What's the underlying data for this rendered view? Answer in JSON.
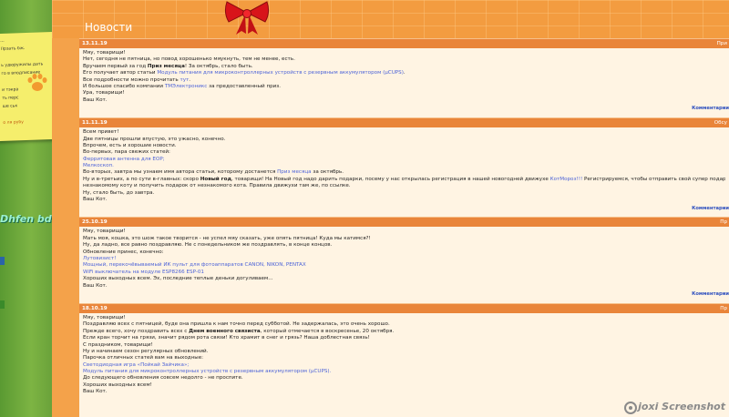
{
  "header": {
    "title": "Новости"
  },
  "sidebar": {
    "note_lines": [
      "...",
      "Прзать бж.",
      "",
      "ь удюружилы дать",
      "го в вподписание",
      "",
      "и тэкра",
      "ть перс",
      "ше ськ",
      "",
      "о ля рубу"
    ],
    "green_caption": "Dhfen bda"
  },
  "posts": [
    {
      "date": "13.11.19",
      "tag": "При",
      "lines": [
        [
          {
            "t": "Мяу, товарищи!"
          }
        ],
        [
          {
            "t": "Нет, сегодня не пятница, но повод хорошенько мяукнуть, тем не менее, есть."
          }
        ],
        [
          {
            "t": "Вручаем первый за год "
          },
          {
            "t": "Приз месяца",
            "b": 1
          },
          {
            "t": "! За октябрь, стало быть."
          }
        ],
        [
          {
            "t": "Его получает автор статьи "
          },
          {
            "t": "Модуль питания для микроконтроллерных устройств с резервным аккумулятором (µCUPS)",
            "l": 1
          },
          {
            "t": "."
          }
        ],
        [
          {
            "t": "Все подробности можно прочитать "
          },
          {
            "t": "тут",
            "l": 1
          },
          {
            "t": "."
          }
        ],
        [
          {
            "t": "И большое спасибо компании "
          },
          {
            "t": "TMЭлектроникс",
            "l": 1
          },
          {
            "t": " за предоставленный приз."
          }
        ],
        [
          {
            "t": "Ура, товарищи!"
          }
        ],
        [
          {
            "t": "Ваш Кот."
          }
        ]
      ],
      "comments": "Комментарии"
    },
    {
      "date": "11.11.19",
      "tag": "Обсу",
      "lines": [
        [
          {
            "t": "Всем привет!"
          }
        ],
        [
          {
            "t": "Две пятницы прошли впустую, это ужасно, конечно."
          }
        ],
        [
          {
            "t": "Впрочем, есть и хорошие новости."
          }
        ],
        [
          {
            "t": "Во-первых, пара свежих статей:"
          }
        ],
        [
          {
            "t": "Ферритовая антенна для ЕОР;",
            "l": 1
          }
        ],
        [
          {
            "t": "Мелкоскоп.",
            "l": 1
          }
        ],
        [
          {
            "t": "Во-вторых, завтра мы узнаем имя автора статьи, которому достанется "
          },
          {
            "t": "Приз месяца",
            "l": 1
          },
          {
            "t": " за октябрь."
          }
        ],
        [
          {
            "t": "Ну и в-третьих, а по сути в-главных: скоро "
          },
          {
            "t": "Новый год",
            "b": 1
          },
          {
            "t": ", товарищи! На Новый год надо дарить подарки, посему у нас открылась регистрация в нашей новогодней движухе "
          },
          {
            "t": "КотМороз!!!",
            "l": 1
          },
          {
            "t": " Регистрируемся, чтобы отправить свой супер подарок"
          }
        ],
        [
          {
            "t": "незнакомому коту и получить подарок от незнакомого кота. Правила движухи там же, по ссылке."
          }
        ],
        [
          {
            "t": "Ну, стало быть, до завтра."
          }
        ],
        [
          {
            "t": "Ваш Кот."
          }
        ]
      ],
      "comments": "Комментарии"
    },
    {
      "date": "25.10.19",
      "tag": "Пр",
      "lines": [
        [
          {
            "t": "Мяу, товарищи!"
          }
        ],
        [
          {
            "t": "Мать моя, кошка, это шож такое творится - не успел мяу сказать, уже опять пятница! Куда мы катимся?!"
          }
        ],
        [
          {
            "t": "Ну, да ладно, все равно поздравляю. Не с понедельником же поздравлять, в конце концов."
          }
        ],
        [
          {
            "t": "Обновление принес, конечно:"
          }
        ],
        [
          {
            "t": "Лутовизист!",
            "l": 1
          }
        ],
        [
          {
            "t": "Мощный, перекочёвываемый ИК пульт для фотоаппаратов CANON, NIKON, PENTAX",
            "l": 1
          }
        ],
        [
          {
            "t": "WiFi выключатель на модуле ESP8266 ESP-01",
            "l": 1
          }
        ],
        [
          {
            "t": "Хороших выходных всем. Эх, последние теплые деньки догуливаем..."
          }
        ],
        [
          {
            "t": "Ваш Кот."
          }
        ]
      ],
      "comments": "Комментарии"
    },
    {
      "date": "18.10.19",
      "tag": "Пр",
      "lines": [
        [
          {
            "t": "Мяу, товарищи!"
          }
        ],
        [
          {
            "t": "Поздравляю всех с пятницей, буде она пришла к нам точно перед субботой. Не задержалась, это очень хорошо."
          }
        ],
        [
          {
            "t": "Прежде всего, хочу поздравить всех с "
          },
          {
            "t": "Днем военного связиста",
            "b": 1
          },
          {
            "t": ", который отмечается в воскресенье, 20 октября."
          }
        ],
        [
          {
            "t": "Если кран торчит на грязи, значит рядом рота связи! Кто храмит в снег и грязь? Наша доблестная связь!"
          }
        ],
        [
          {
            "t": "С праздником, товарищи!"
          }
        ],
        [
          {
            "t": "Ну и начинаем сезон регулярных обновлений."
          }
        ],
        [
          {
            "t": "Парочка отличных статей вам на выходные:"
          }
        ],
        [
          {
            "t": "Светодиодная игра «Пойкай Зайчика»;",
            "l": 1
          }
        ],
        [
          {
            "t": "Модуль питания для микроконтроллерных устройств с резервным аккумулятором (µCUPS).",
            "l": 1
          }
        ],
        [
          {
            "t": "До следующего обновления совсем недолго - не проспите."
          }
        ],
        [
          {
            "t": "Хороших выходных всем!"
          }
        ],
        [
          {
            "t": "Ваш Кот."
          }
        ]
      ],
      "comments": ""
    }
  ],
  "watermark": {
    "text": "joxi Screenshot"
  },
  "colors": {
    "page_bg": "#f4a24a",
    "content_bg": "#fff4e3",
    "post_header": "#e9853a",
    "link": "#4c63d8"
  }
}
